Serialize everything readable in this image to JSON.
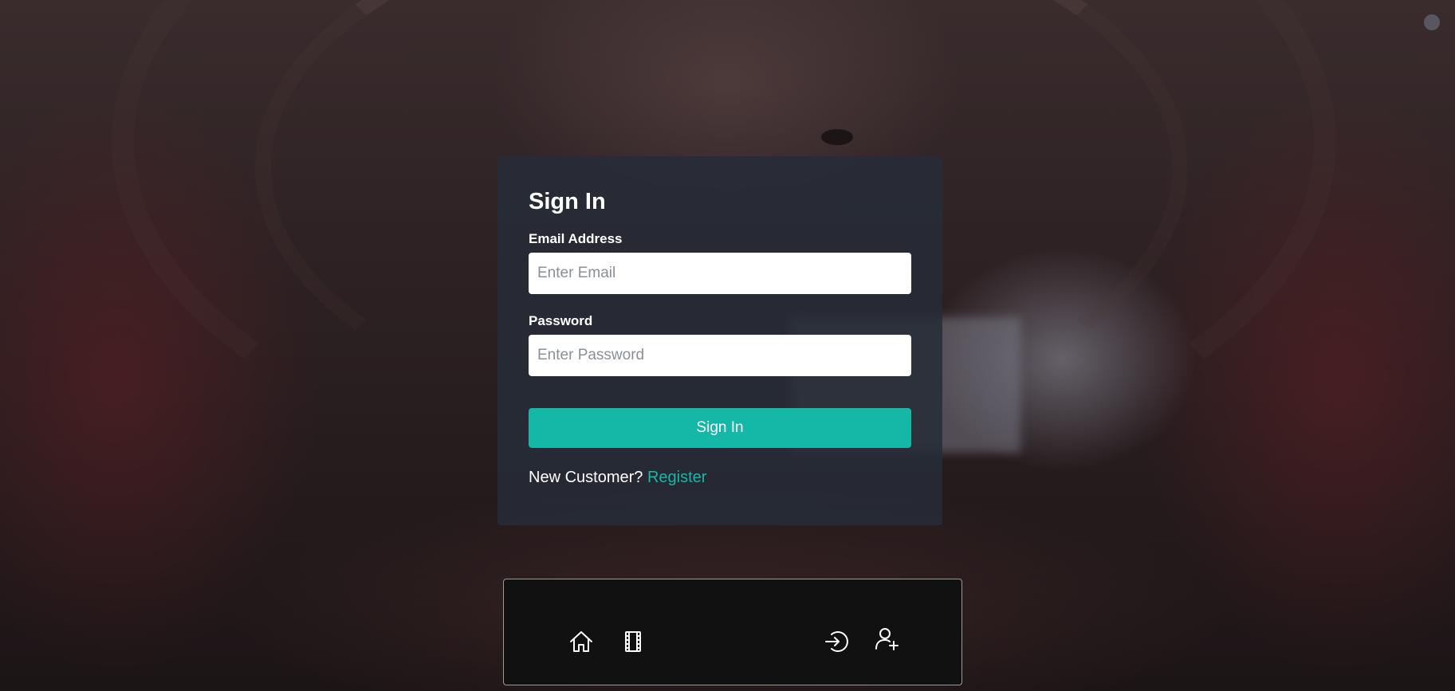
{
  "signin": {
    "title": "Sign In",
    "email_label": "Email Address",
    "email_placeholder": "Enter Email",
    "email_value": "",
    "password_label": "Password",
    "password_placeholder": "Enter Password",
    "password_value": "",
    "submit_label": "Sign In",
    "new_customer_text": "New Customer?",
    "register_link": "Register"
  },
  "nav": {
    "icons": [
      "home-icon",
      "film-icon",
      "login-icon",
      "user-plus-icon"
    ]
  },
  "colors": {
    "accent": "#15b8a6",
    "card_bg": "#262c38",
    "nav_bg": "#111111"
  }
}
